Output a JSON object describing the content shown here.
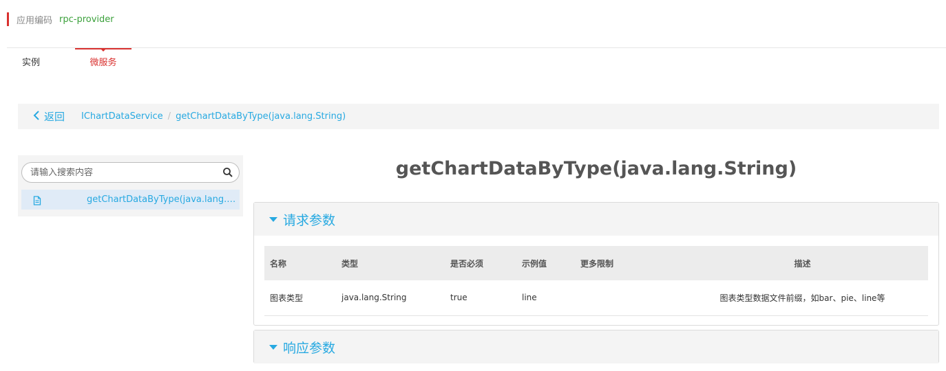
{
  "header": {
    "label": "应用编码",
    "code": "rpc-provider"
  },
  "tabs": [
    {
      "label": "实例",
      "active": false
    },
    {
      "label": "微服务",
      "active": true
    }
  ],
  "breadcrumb": {
    "back_label": "返回",
    "items": [
      "IChartDataService",
      "getChartDataByType(java.lang.String)"
    ],
    "separator": "/"
  },
  "sidebar": {
    "search": {
      "placeholder": "请输入搜索内容",
      "value": ""
    },
    "items": [
      {
        "label": "getChartDataByType(java.lang.S..."
      }
    ]
  },
  "main": {
    "title": "getChartDataByType(java.lang.String)",
    "request_panel": {
      "title": "请求参数",
      "columns": [
        "名称",
        "类型",
        "是否必须",
        "示例值",
        "更多限制",
        "描述"
      ],
      "rows": [
        [
          "图表类型",
          "java.lang.String",
          "true",
          "line",
          "",
          "图表类型数据文件前缀，如bar、pie、line等"
        ]
      ]
    },
    "response_panel": {
      "title": "响应参数"
    }
  },
  "colors": {
    "accent": "#27a9e1",
    "brand_red": "#d9312f",
    "code_green": "#3aa03a"
  }
}
